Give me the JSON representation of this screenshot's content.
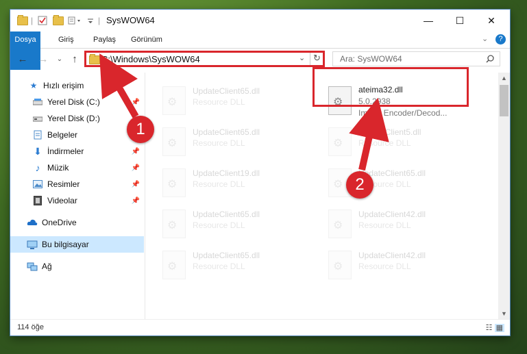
{
  "window": {
    "title": "SysWOW64",
    "controls": {
      "minimize": "—",
      "maximize": "☐",
      "close": "✕"
    }
  },
  "ribbon": {
    "tabs": [
      "Dosya",
      "Giriş",
      "Paylaş",
      "Görünüm"
    ],
    "help_icon": "?"
  },
  "address_bar": {
    "path": "C:\\Windows\\SysWOW64",
    "refresh_icon": "↻"
  },
  "search": {
    "placeholder": "Ara: SysWOW64"
  },
  "sidebar": {
    "items": [
      {
        "label": "Hızlı erişim",
        "icon": "star-icon",
        "pinned": false
      },
      {
        "label": "Yerel Disk (C:)",
        "icon": "drive-icon",
        "pinned": true
      },
      {
        "label": "Yerel Disk (D:)",
        "icon": "drive-icon",
        "pinned": false
      },
      {
        "label": "Belgeler",
        "icon": "documents-icon",
        "pinned": false
      },
      {
        "label": "İndirmeler",
        "icon": "download-icon",
        "pinned": true
      },
      {
        "label": "Müzik",
        "icon": "music-icon",
        "pinned": true
      },
      {
        "label": "Resimler",
        "icon": "pictures-icon",
        "pinned": true
      },
      {
        "label": "Videolar",
        "icon": "videos-icon",
        "pinned": true
      },
      {
        "label": "OneDrive",
        "icon": "cloud-icon",
        "pinned": false
      },
      {
        "label": "Bu bilgisayar",
        "icon": "computer-icon",
        "pinned": false,
        "selected": true
      },
      {
        "label": "Ağ",
        "icon": "network-icon",
        "pinned": false
      }
    ]
  },
  "files": {
    "target": {
      "name": "ateima32.dll",
      "version": "5.0.2938",
      "description": "Image Encoder/Decod..."
    },
    "left_column": [
      {
        "name": "UpdateClient65.dll",
        "desc": "Resource DLL"
      },
      {
        "name": "UpdateClient65.dll",
        "desc": "Resource DLL"
      },
      {
        "name": "UpdateClient19.dll",
        "desc": "Resource DLL"
      },
      {
        "name": "UpdateClient65.dll",
        "desc": "Resource DLL"
      },
      {
        "name": "UpdateClient65.dll",
        "desc": "Resource DLL"
      }
    ],
    "right_column": [
      {
        "name": "UpdateClient5.dll",
        "desc": "Resource DLL"
      },
      {
        "name": "UpdateClient65.dll",
        "desc": "Resource DLL"
      },
      {
        "name": "UpdateClient42.dll",
        "desc": "Resource DLL"
      },
      {
        "name": "UpdateClient42.dll",
        "desc": "Resource DLL"
      }
    ]
  },
  "status": {
    "count": "114 öğe"
  },
  "annotations": {
    "badge1": "1",
    "badge2": "2",
    "color": "#d9262c"
  }
}
